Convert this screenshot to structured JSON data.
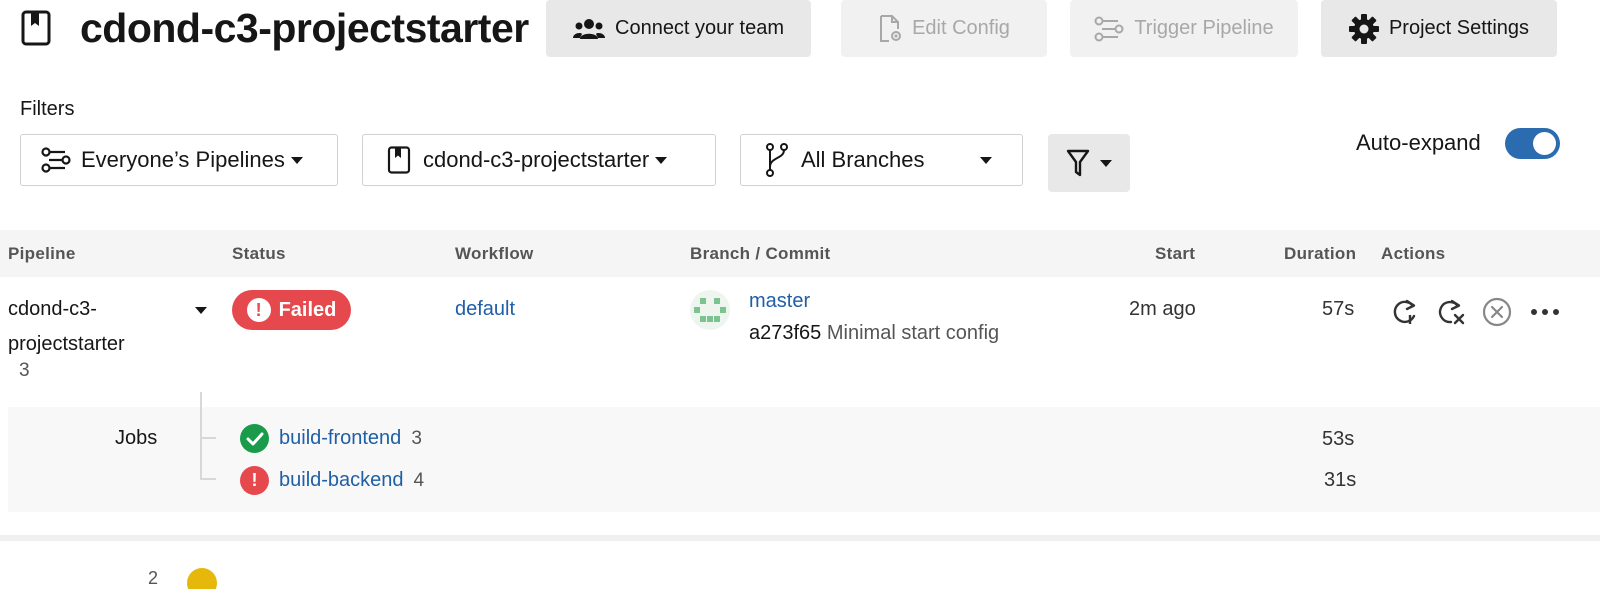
{
  "header": {
    "title": "cdond-c3-projectstarter",
    "buttons": {
      "connect_team": "Connect your team",
      "edit_config": "Edit Config",
      "trigger_pipeline": "Trigger Pipeline",
      "project_settings": "Project Settings"
    }
  },
  "filters": {
    "label": "Filters",
    "pipelines": "Everyone’s Pipelines",
    "project": "cdond-c3-projectstarter",
    "branches": "All Branches",
    "auto_expand_label": "Auto-expand",
    "auto_expand_on": true
  },
  "table": {
    "headers": {
      "pipeline": "Pipeline",
      "status": "Status",
      "workflow": "Workflow",
      "branch_commit": "Branch / Commit",
      "start": "Start",
      "duration": "Duration",
      "actions": "Actions"
    },
    "row": {
      "pipeline_name": "cdond-c3-projectstarter",
      "pipeline_number": "3",
      "status": "Failed",
      "workflow": "default",
      "branch": "master",
      "commit_hash": "a273f65",
      "commit_message": "Minimal start config",
      "start": "2m ago",
      "duration": "57s"
    },
    "jobs": {
      "label": "Jobs",
      "items": [
        {
          "name": "build-frontend",
          "number": "3",
          "duration": "53s",
          "status": "success"
        },
        {
          "name": "build-backend",
          "number": "4",
          "duration": "31s",
          "status": "failed"
        }
      ]
    },
    "next_row": {
      "pipeline_number": "2"
    }
  },
  "colors": {
    "failed": "#e5484d",
    "success": "#1a9b4b",
    "link": "#1f5fa6",
    "toggle": "#2b6cb0",
    "running": "#e5b80b"
  }
}
